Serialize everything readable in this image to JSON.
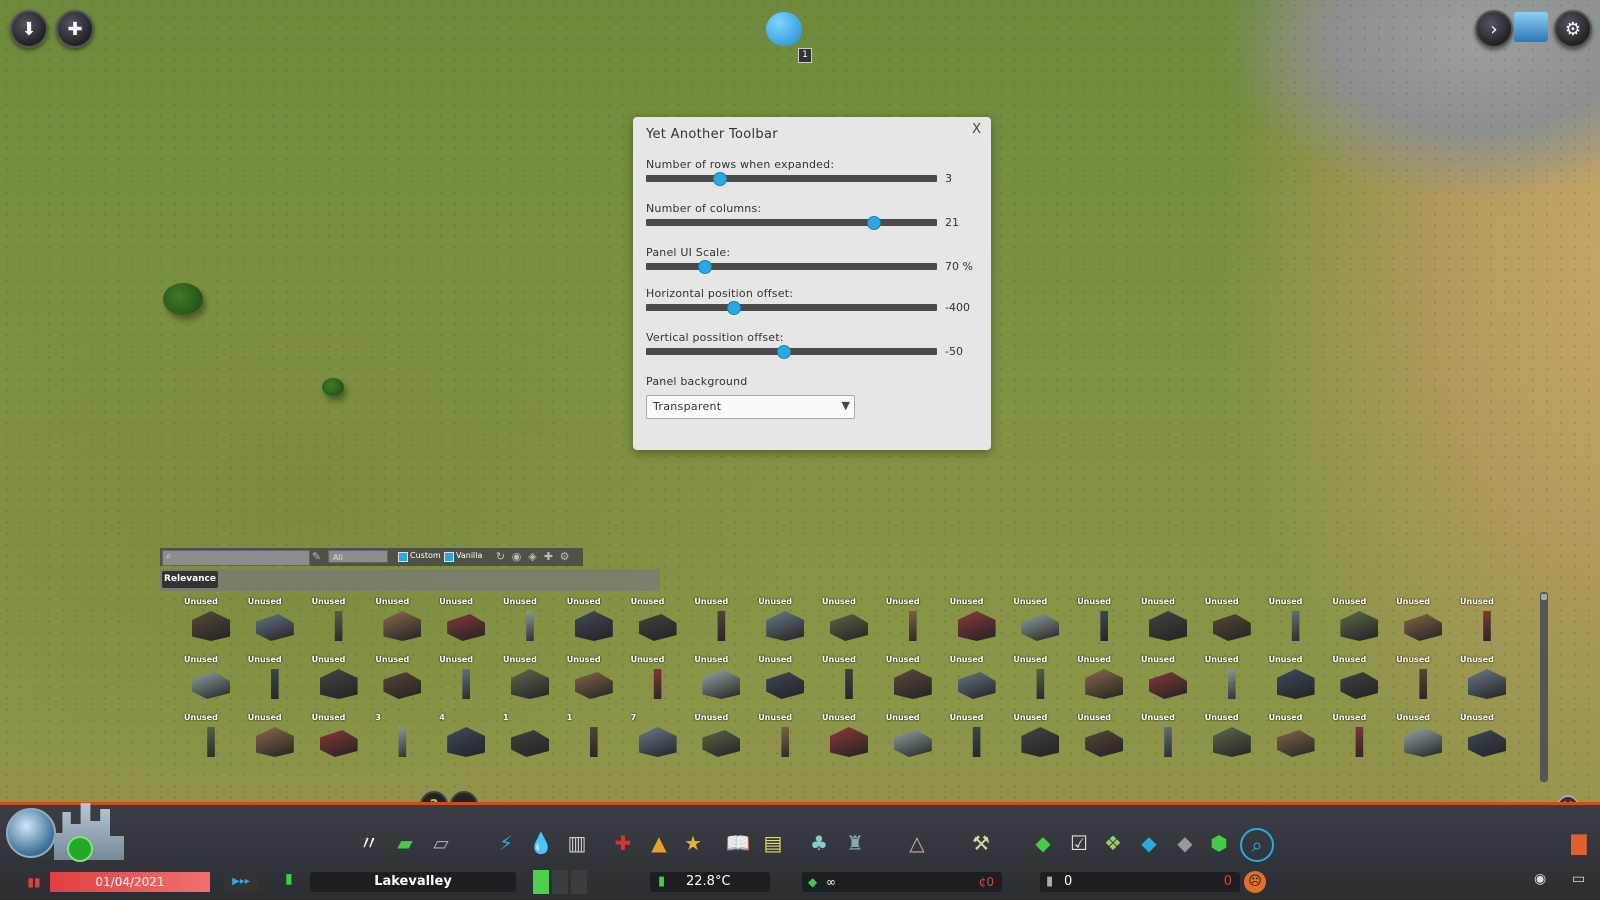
{
  "dialog": {
    "title": "Yet Another Toolbar",
    "close": "X",
    "settings": [
      {
        "label": "Number of rows when expanded:",
        "value": "3",
        "fraction": 0.25
      },
      {
        "label": "Number of columns:",
        "value": "21",
        "fraction": 0.78
      },
      {
        "label": "Panel UI Scale:",
        "value": "70 %",
        "fraction": 0.2
      },
      {
        "label": "Horizontal position offset:",
        "value": "-400",
        "fraction": 0.3
      },
      {
        "label": "Vertical possition offset:",
        "value": "-50",
        "fraction": 0.47
      }
    ],
    "background_label": "Panel background",
    "background_value": "Transparent"
  },
  "filter_bar": {
    "search_placeholder": "",
    "category": "All",
    "custom_label": "Custom",
    "vanilla_label": "Vanilla",
    "sort_label": "Relevance"
  },
  "asset_grid": {
    "row1": [
      "Unused",
      "Unused",
      "Unused",
      "Unused",
      "Unused",
      "Unused",
      "Unused",
      "Unused",
      "Unused",
      "Unused",
      "Unused",
      "Unused",
      "Unused",
      "Unused",
      "Unused",
      "Unused",
      "Unused",
      "Unused",
      "Unused",
      "Unused",
      "Unused"
    ],
    "row2": [
      "Unused",
      "Unused",
      "Unused",
      "Unused",
      "Unused",
      "Unused",
      "Unused",
      "Unused",
      "Unused",
      "Unused",
      "Unused",
      "Unused",
      "Unused",
      "Unused",
      "Unused",
      "Unused",
      "Unused",
      "Unused",
      "Unused",
      "Unused",
      "Unused"
    ],
    "row3": [
      "Unused",
      "Unused",
      "Unused",
      "3",
      "4",
      "1",
      "1",
      "7",
      "Unused",
      "Unused",
      "Unused",
      "Unused",
      "Unused",
      "Unused",
      "Unused",
      "Unused",
      "Unused",
      "Unused",
      "Unused",
      "Unused",
      "Unused"
    ]
  },
  "status": {
    "date": "01/04/2021",
    "city_name": "Lakevalley",
    "temperature": "22.8°C",
    "money": "∞",
    "money_change": "¢0",
    "population": "0",
    "population_change": "0",
    "chirper_count": "1"
  },
  "colors": {
    "accent": "#29a9e1",
    "warning": "#e05a4a",
    "date_red": "#e04040"
  }
}
